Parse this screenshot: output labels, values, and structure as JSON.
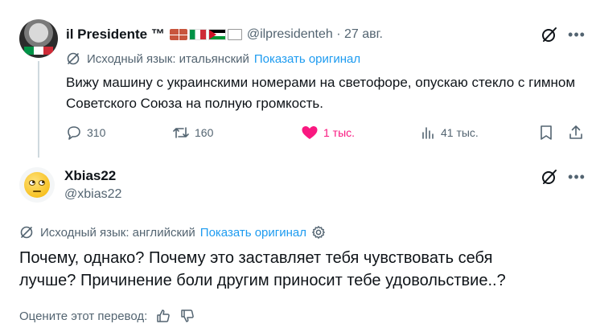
{
  "tweet1": {
    "display_name": "il Presidente ™",
    "emojis": [
      "brick-emoji",
      "italy-flag-emoji",
      "palestine-flag-emoji",
      "white-flag-emoji"
    ],
    "handle_date": "@ilpresidenteh · 27 авг.",
    "translation": {
      "source_label": "Исходный язык: итальянский",
      "show_original": "Показать оригинал"
    },
    "text": "Вижу машину с украинскими номерами на светофоре, опускаю стекло с гимном Советского Союза на полную громкость.",
    "actions": {
      "replies": "310",
      "reposts": "160",
      "likes": "1 тыс.",
      "views": "41 тыс."
    }
  },
  "tweet2": {
    "display_name": "Xbias22",
    "handle": "@xbias22",
    "avatar_emoji": "face-with-rolling-eyes",
    "translation": {
      "source_label": "Исходный язык: английский",
      "show_original": "Показать оригинал"
    },
    "text_line1": "Почему, однако? Почему это заставляет тебя чувствовать себя",
    "text_line2": "лучше? Причинение боли другим приносит тебе удовольствие..?",
    "rate_label": "Оцените этот перевод:"
  },
  "colors": {
    "text": "#0f1419",
    "secondary": "#536471",
    "link": "#1d9bf0",
    "like": "#f91880"
  }
}
